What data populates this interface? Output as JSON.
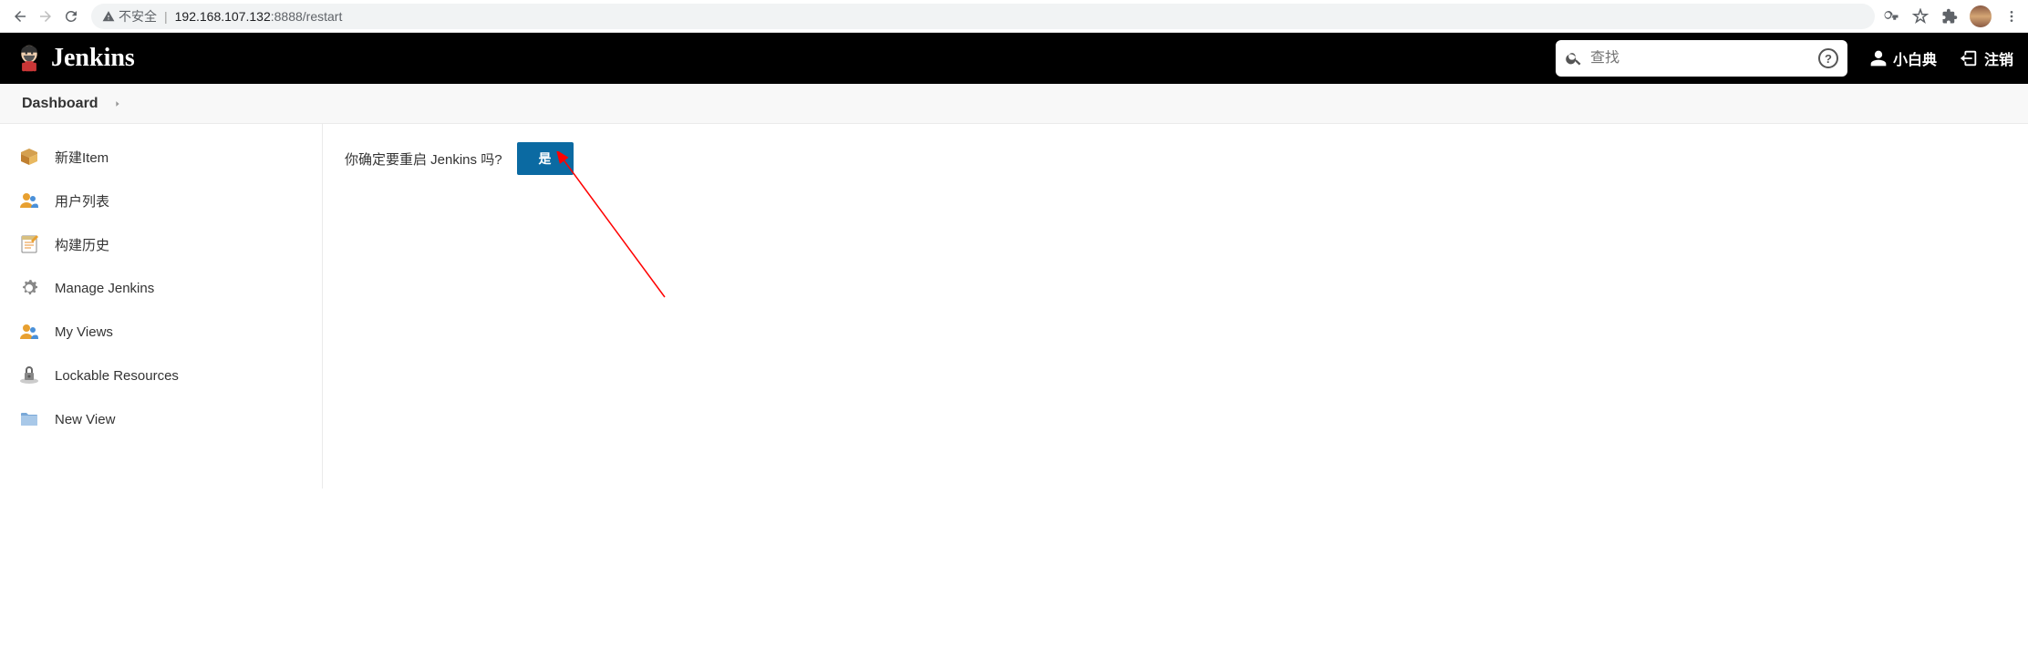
{
  "browser": {
    "insecure_label": "不安全",
    "url_host": "192.168.107.132",
    "url_port": ":8888",
    "url_path": "/restart"
  },
  "header": {
    "brand": "Jenkins",
    "search_placeholder": "查找",
    "user_label": "小白典",
    "logout_label": "注销"
  },
  "breadcrumb": {
    "item": "Dashboard"
  },
  "sidebar": {
    "items": [
      {
        "label": "新建Item"
      },
      {
        "label": "用户列表"
      },
      {
        "label": "构建历史"
      },
      {
        "label": "Manage Jenkins"
      },
      {
        "label": "My Views"
      },
      {
        "label": "Lockable Resources"
      },
      {
        "label": "New View"
      }
    ]
  },
  "main": {
    "confirm_text": "你确定要重启 Jenkins 吗?",
    "yes_label": "是"
  }
}
